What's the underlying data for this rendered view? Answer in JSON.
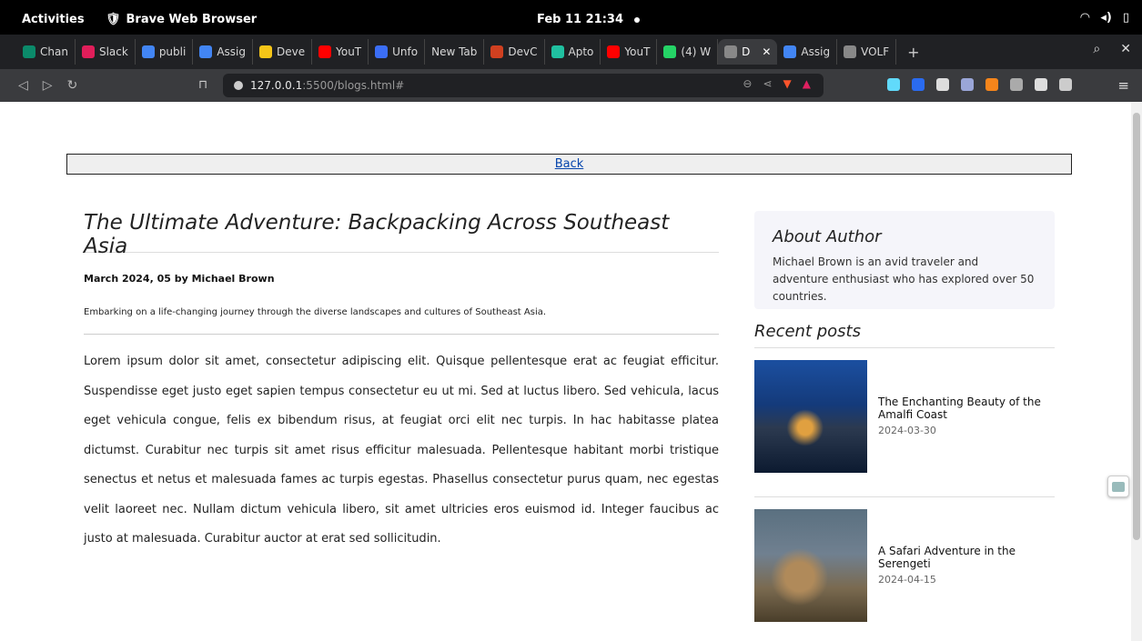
{
  "system": {
    "activities": "Activities",
    "app_name": "Brave Web Browser",
    "clock": "Feb 11 21:34"
  },
  "tabs": [
    {
      "label": "Chan",
      "color": "#0b8a6a"
    },
    {
      "label": "Slack",
      "color": "#e01e5a"
    },
    {
      "label": "publi",
      "color": "#4285f4"
    },
    {
      "label": "Assig",
      "color": "#4285f4"
    },
    {
      "label": "Deve",
      "color": "#f5c518"
    },
    {
      "label": "YouT",
      "color": "#ff0000"
    },
    {
      "label": "Unfo",
      "color": "#3b6ef5"
    },
    {
      "label": "New Tab",
      "color": ""
    },
    {
      "label": "DevC",
      "color": "#d04020"
    },
    {
      "label": "Apto",
      "color": "#20c0a0"
    },
    {
      "label": "YouT",
      "color": "#ff0000"
    },
    {
      "label": "(4) W",
      "color": "#25d366"
    },
    {
      "label": "D",
      "color": "#888888",
      "active": true
    },
    {
      "label": "Assig",
      "color": "#4285f4"
    },
    {
      "label": "VOLF",
      "color": "#888888"
    }
  ],
  "browser": {
    "url_host": "127.0.0.1",
    "url_rest": ":5500/blogs.html#",
    "new_tab": "+"
  },
  "page": {
    "back_link": "Back",
    "article": {
      "title": "The Ultimate Adventure: Backpacking Across Southeast Asia",
      "meta": "March 2024, 05 by Michael Brown",
      "excerpt": "Embarking on a life-changing journey through the diverse landscapes and cultures of Southeast Asia.",
      "body": "Lorem ipsum dolor sit amet, consectetur adipiscing elit. Quisque pellentesque erat ac feugiat efficitur. Suspendisse eget justo eget sapien tempus consectetur eu ut mi. Sed at luctus libero. Sed vehicula, lacus eget vehicula congue, felis ex bibendum risus, at feugiat orci elit nec turpis. In hac habitasse platea dictumst. Curabitur nec turpis sit amet risus efficitur malesuada. Pellentesque habitant morbi tristique senectus et netus et malesuada fames ac turpis egestas. Phasellus consectetur purus quam, nec egestas velit laoreet nec. Nullam dictum vehicula libero, sit amet ultricies eros euismod id. Integer faucibus ac justo at malesuada. Curabitur auctor at erat sed sollicitudin."
    },
    "about": {
      "title": "About Author",
      "text": "Michael Brown is an avid traveler and adventure enthusiast who has explored over 50 countries."
    },
    "recent": {
      "title": "Recent posts",
      "posts": [
        {
          "title": "The Enchanting Beauty of the Amalfi Coast",
          "date": "2024-03-30"
        },
        {
          "title": "A Safari Adventure in the Serengeti",
          "date": "2024-04-15"
        }
      ]
    }
  }
}
